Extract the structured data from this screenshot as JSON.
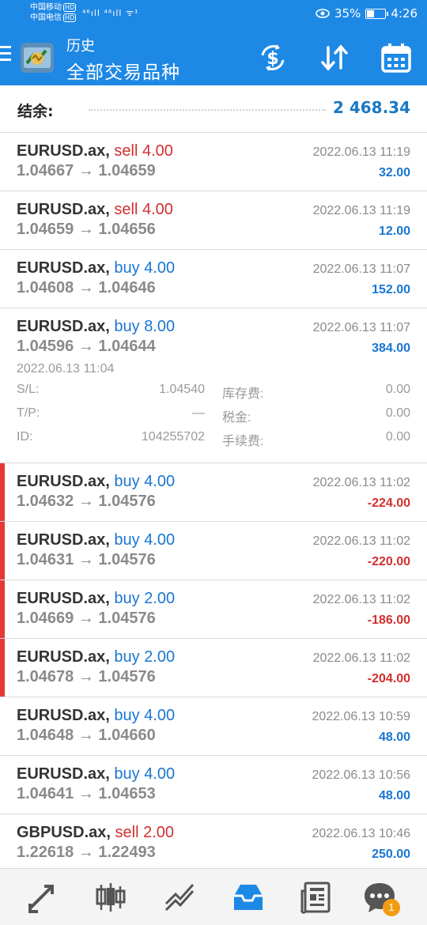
{
  "status_bar": {
    "carrier1": "中国移动",
    "carrier2": "中国电信",
    "hd": "HD",
    "signal": "⁴⁶ıll ⁴⁶ıll ᯤ¹",
    "battery": "35%",
    "battery_level": 0.35,
    "time": "4:26"
  },
  "header": {
    "title": "历史",
    "subtitle": "全部交易品种",
    "icons": [
      "menu-icon",
      "metatrader-logo",
      "currency-exchange-icon",
      "sort-icon",
      "calendar-icon"
    ]
  },
  "balance": {
    "label": "结余:",
    "value": "2 468.34"
  },
  "trades": [
    {
      "symbol": "EURUSD.ax,",
      "side": "sell",
      "volume": "4.00",
      "prices": "1.04667 → 1.04659",
      "time": "2022.06.13 11:19",
      "profit": "32.00",
      "loss": false
    },
    {
      "symbol": "EURUSD.ax,",
      "side": "sell",
      "volume": "4.00",
      "prices": "1.04659 → 1.04656",
      "time": "2022.06.13 11:19",
      "profit": "12.00",
      "loss": false
    },
    {
      "symbol": "EURUSD.ax,",
      "side": "buy",
      "volume": "4.00",
      "prices": "1.04608 → 1.04646",
      "time": "2022.06.13 11:07",
      "profit": "152.00",
      "loss": false
    },
    {
      "symbol": "EURUSD.ax,",
      "side": "buy",
      "volume": "8.00",
      "prices": "1.04596 → 1.04644",
      "time": "2022.06.13 11:07",
      "profit": "384.00",
      "loss": false,
      "details": {
        "open_time": "2022.06.13 11:04",
        "sl_label": "S/L:",
        "sl_value": "1.04540",
        "tp_label": "T/P:",
        "tp_value": "—",
        "id_label": "ID:",
        "id_value": "104255702",
        "swap_label": "库存费:",
        "swap_value": "0.00",
        "tax_label": "税金:",
        "tax_value": "0.00",
        "fee_label": "手续费:",
        "fee_value": "0.00"
      }
    },
    {
      "symbol": "EURUSD.ax,",
      "side": "buy",
      "volume": "4.00",
      "prices": "1.04632 → 1.04576",
      "time": "2022.06.13 11:02",
      "profit": "-224.00",
      "loss": true
    },
    {
      "symbol": "EURUSD.ax,",
      "side": "buy",
      "volume": "4.00",
      "prices": "1.04631 → 1.04576",
      "time": "2022.06.13 11:02",
      "profit": "-220.00",
      "loss": true
    },
    {
      "symbol": "EURUSD.ax,",
      "side": "buy",
      "volume": "2.00",
      "prices": "1.04669 → 1.04576",
      "time": "2022.06.13 11:02",
      "profit": "-186.00",
      "loss": true
    },
    {
      "symbol": "EURUSD.ax,",
      "side": "buy",
      "volume": "2.00",
      "prices": "1.04678 → 1.04576",
      "time": "2022.06.13 11:02",
      "profit": "-204.00",
      "loss": true
    },
    {
      "symbol": "EURUSD.ax,",
      "side": "buy",
      "volume": "4.00",
      "prices": "1.04648 → 1.04660",
      "time": "2022.06.13 10:59",
      "profit": "48.00",
      "loss": false
    },
    {
      "symbol": "EURUSD.ax,",
      "side": "buy",
      "volume": "4.00",
      "prices": "1.04641 → 1.04653",
      "time": "2022.06.13 10:56",
      "profit": "48.00",
      "loss": false
    },
    {
      "symbol": "GBPUSD.ax,",
      "side": "sell",
      "volume": "2.00",
      "prices": "1.22618 → 1.22493",
      "time": "2022.06.13 10:46",
      "profit": "250.00",
      "loss": false
    }
  ],
  "bottom_nav": {
    "items": [
      "quotes-icon",
      "chart-icon",
      "trade-icon",
      "history-icon",
      "news-icon",
      "chat-icon"
    ],
    "active": "history-icon",
    "chat_badge": "1"
  },
  "colors": {
    "header_bg": "#1e88e5",
    "profit_positive": "#1976d2",
    "profit_negative": "#d32f2f",
    "sell": "#d32f2f",
    "buy": "#1976d2",
    "loss_marker": "#e53935"
  }
}
